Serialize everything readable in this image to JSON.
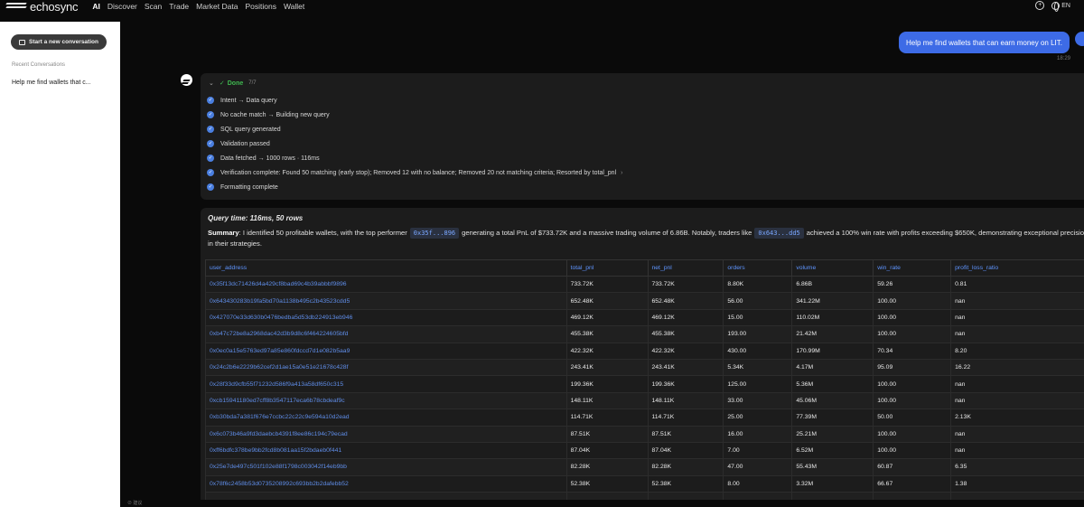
{
  "app": {
    "name": "echosync"
  },
  "nav": {
    "items": [
      "AI",
      "Discover",
      "Scan",
      "Trade",
      "Market Data",
      "Positions",
      "Wallet"
    ]
  },
  "topbar": {
    "add_icon": "plus-circle-icon",
    "lang": "EN"
  },
  "sidebar": {
    "new_conversation": "Start a new conversation",
    "recent_label": "Recent Conversations",
    "recent_items": [
      "Help me find wallets that c..."
    ]
  },
  "chat": {
    "user_message": "Help me find wallets that can earn money on LIT.",
    "user_time": "18:29",
    "status": {
      "label": "Done",
      "count": "7/7",
      "elapsed": "62s"
    },
    "steps": [
      "Intent → Data query",
      "No cache match → Building new query",
      "SQL query generated",
      "Validation passed",
      "Data fetched → 1000 rows · 116ms",
      "Verification complete: Found 50 matching (early stop); Removed 12 with no balance; Removed 20 not matching criteria; Resorted by total_pnl",
      "Formatting complete"
    ],
    "query_time": "Query time: 116ms, 50 rows",
    "summary": {
      "label": "Summary",
      "part1": ": I identified 50 profitable wallets, with the top performer",
      "addr1": "0x35f...896",
      "part2": "generating a total PnL of $733.72K and a massive trading volume of 6.86B. Notably, traders like",
      "addr2": "0x643...dd5",
      "part3": "achieved a 100% win rate with profits exceeding $650K, demonstrating exceptional precision in their strategies."
    }
  },
  "table": {
    "columns": [
      "user_address",
      "total_pnl",
      "net_pnl",
      "orders",
      "volume",
      "win_rate",
      "profit_loss_ratio"
    ],
    "rows": [
      [
        "0x35f13dc71426d4a429cf8bad69c4b39abbbf9896",
        "733.72K",
        "733.72K",
        "8.80K",
        "6.86B",
        "59.26",
        "0.81"
      ],
      [
        "0x643430283b19fa5bd70a1138b495c2b43523cdd5",
        "652.48K",
        "652.48K",
        "56.00",
        "341.22M",
        "100.00",
        "nan"
      ],
      [
        "0x427070e33d630b0476bedba5d53db224913eb946",
        "469.12K",
        "469.12K",
        "15.00",
        "110.02M",
        "100.00",
        "nan"
      ],
      [
        "0xb47c72be8a2968dac42d3b9d8c6f464224605bfd",
        "455.38K",
        "455.38K",
        "193.00",
        "21.42M",
        "100.00",
        "nan"
      ],
      [
        "0x0ec0a15e5763ed97a85e860fdccd7d1e082b5aa9",
        "422.32K",
        "422.32K",
        "430.00",
        "170.99M",
        "70.34",
        "8.20"
      ],
      [
        "0x24c2b6e2229b62cef2d1ae15a0e51e21678c428f",
        "243.41K",
        "243.41K",
        "5.34K",
        "4.17M",
        "95.09",
        "16.22"
      ],
      [
        "0x28f33d9cfb55f71232d586f9a413a58df650c315",
        "199.36K",
        "199.36K",
        "125.00",
        "5.36M",
        "100.00",
        "nan"
      ],
      [
        "0xcb15941180ed7cff8b3547117eca6b78cbdeaf9c",
        "148.11K",
        "148.11K",
        "33.00",
        "45.06M",
        "100.00",
        "nan"
      ],
      [
        "0xb30bda7a381f676e7ccbc22c22c9e594a10d2ead",
        "114.71K",
        "114.71K",
        "25.00",
        "77.39M",
        "50.00",
        "2.13K"
      ],
      [
        "0x6c073b46a9fd3daebcb4391f8ee86c194c79ecad",
        "87.51K",
        "87.51K",
        "16.00",
        "25.21M",
        "100.00",
        "nan"
      ],
      [
        "0xff6bdfc378be9bb2fcd8b081aa15f2bdaeb0f441",
        "87.04K",
        "87.04K",
        "7.00",
        "6.52M",
        "100.00",
        "nan"
      ],
      [
        "0x25e7de497c501f102e88f1798c003042f14eb9bb",
        "82.28K",
        "82.28K",
        "47.00",
        "55.43M",
        "60.87",
        "6.35"
      ],
      [
        "0x78f6c2458b53d0735208992c693bb2b2dafebb52",
        "52.38K",
        "52.38K",
        "8.00",
        "3.32M",
        "66.67",
        "1.38"
      ],
      [
        "",
        "",
        "",
        "",
        "",
        "",
        ""
      ]
    ]
  },
  "footer": {
    "text": "⊘ 建议"
  }
}
